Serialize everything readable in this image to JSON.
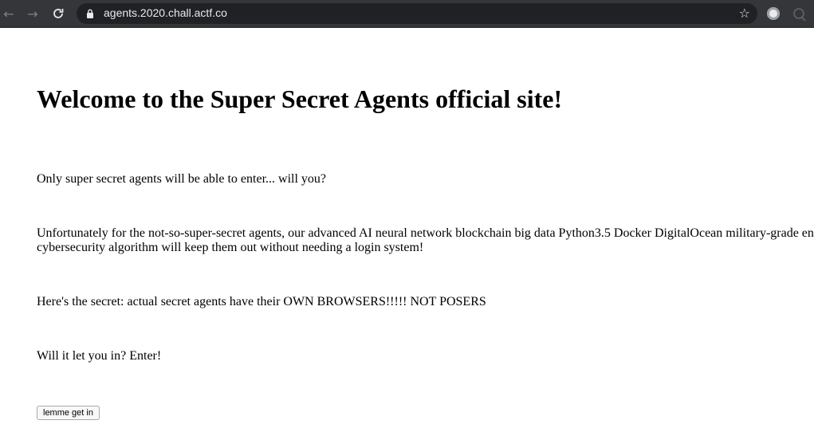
{
  "browser": {
    "url": "agents.2020.chall.actf.co",
    "back_icon": "arrow-left",
    "forward_icon": "arrow-right",
    "reload_icon": "reload",
    "bookmark_icon": "star"
  },
  "page": {
    "heading": "Welcome to the Super Secret Agents official site!",
    "paragraphs": [
      "Only super secret agents will be able to enter... will you?",
      "Unfortunately for the not-so-super-secret agents, our advanced AI neural network blockchain big data Python3.5 Docker DigitalOcean military-grade en",
      "cybersecurity algorithm will keep them out without needing a login system!",
      "Here's the secret: actual secret agents have their OWN BROWSERS!!!!! NOT POSERS",
      "Will it let you in? Enter!"
    ],
    "button_label": "lemme get in"
  }
}
